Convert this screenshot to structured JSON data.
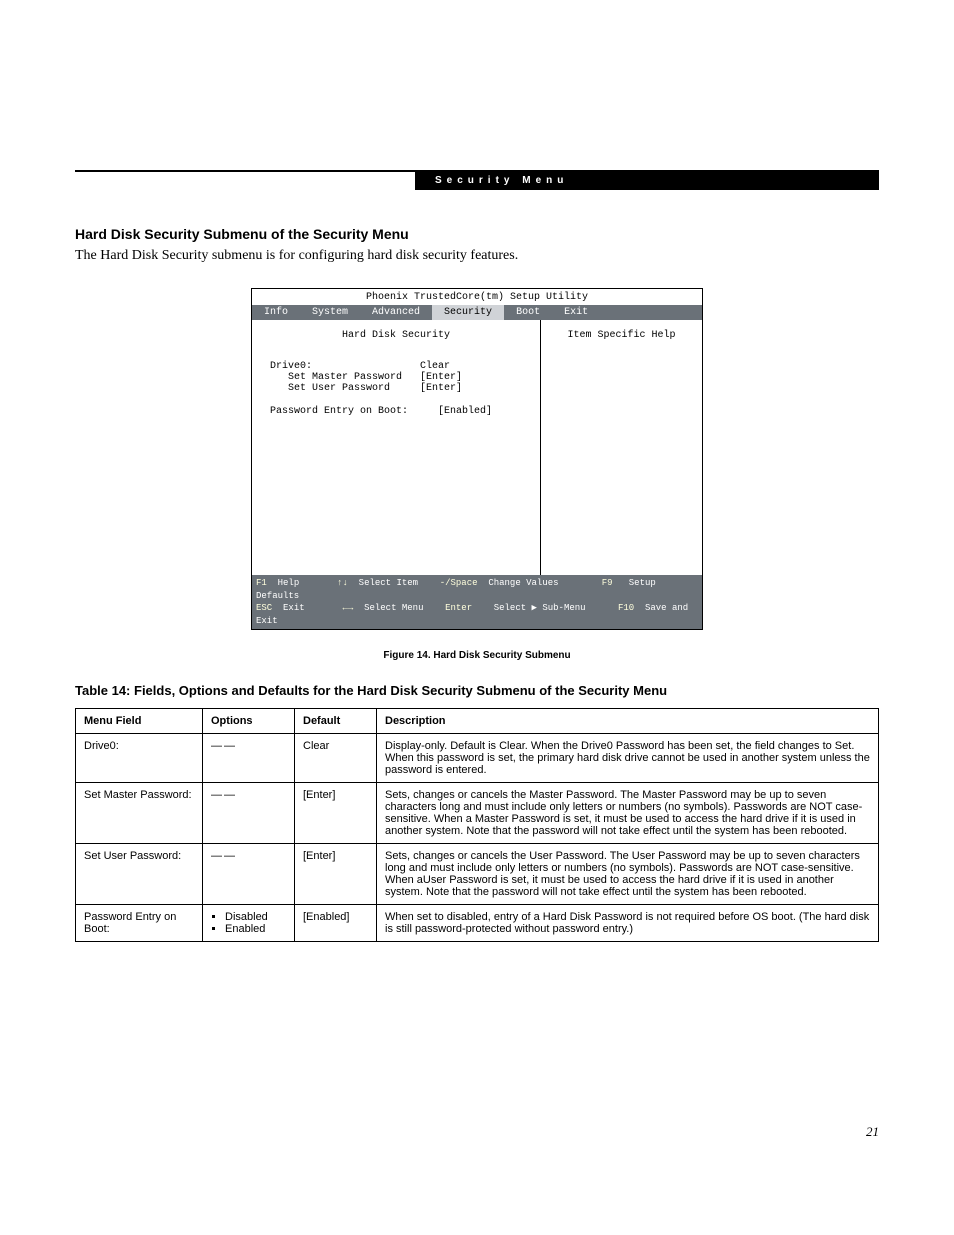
{
  "header": {
    "section": "Security Menu"
  },
  "section_title": "Hard Disk Security Submenu of the Security Menu",
  "intro": "The Hard Disk Security submenu is for configuring hard disk security features.",
  "bios": {
    "title": "Phoenix TrustedCore(tm) Setup Utility",
    "tabs": [
      "Info",
      "System",
      "Advanced",
      "Security",
      "Boot",
      "Exit"
    ],
    "submenu_title": "Hard Disk Security",
    "help_title": "Item Specific Help",
    "rows": {
      "drive0_label": "Drive0:",
      "drive0_value": "Clear",
      "master_label": "Set Master Password",
      "master_value": "[Enter]",
      "user_label": "Set User Password",
      "user_value": "[Enter]",
      "entry_label": "Password Entry on Boot:",
      "entry_value": "[Enabled]"
    },
    "footer": {
      "f1": "F1",
      "help": "Help",
      "ud": "↑↓",
      "select_item": "Select Item",
      "space": "-/Space",
      "change_values": "Change Values",
      "f9": "F9",
      "setup_defaults": "Setup Defaults",
      "esc": "ESC",
      "exit": "Exit",
      "lr": "←→",
      "select_menu": "Select Menu",
      "enter": "Enter",
      "select_sub": "Select ▶ Sub-Menu",
      "f10": "F10",
      "save_exit": "Save and Exit"
    }
  },
  "figure_caption": "Figure 14.   Hard Disk Security Submenu",
  "table_title": "Table 14: Fields, Options and Defaults for the Hard Disk Security Submenu of the Security Menu",
  "table": {
    "headers": [
      "Menu Field",
      "Options",
      "Default",
      "Description"
    ],
    "rows": [
      {
        "field": "Drive0:",
        "options_dash": "——",
        "default": "Clear",
        "desc": "Display-only. Default is Clear. When the Drive0 Password has been set, the field changes to Set. When this password is set, the primary hard disk drive cannot be used in another system unless the password is entered."
      },
      {
        "field": "Set Master Password:",
        "options_dash": "——",
        "default": "[Enter]",
        "desc": "Sets, changes or cancels the Master Password. The Master Password may be up to seven characters long and must include only letters or numbers (no symbols). Passwords are NOT case-sensitive. When a Master Password is set, it must be used to access the hard drive if it is used in another system. Note that the password will not take effect until the system has been rebooted."
      },
      {
        "field": "Set User Password:",
        "options_dash": "——",
        "default": "[Enter]",
        "desc": "Sets, changes or cancels the User Password. The User Password may be up to seven characters long and must include only letters or numbers (no symbols). Passwords are NOT case-sensitive. When aUser Password is set, it must be used to access the hard drive if it is used in another system. Note that the password will not take effect until the system has been rebooted."
      },
      {
        "field": "Password Entry on Boot:",
        "options_list": [
          "Disabled",
          "Enabled"
        ],
        "default": "[Enabled]",
        "desc": "When set to disabled, entry of a Hard Disk Password is not required before OS boot. (The hard disk is still password-protected without password entry.)"
      }
    ]
  },
  "page_number": "21"
}
